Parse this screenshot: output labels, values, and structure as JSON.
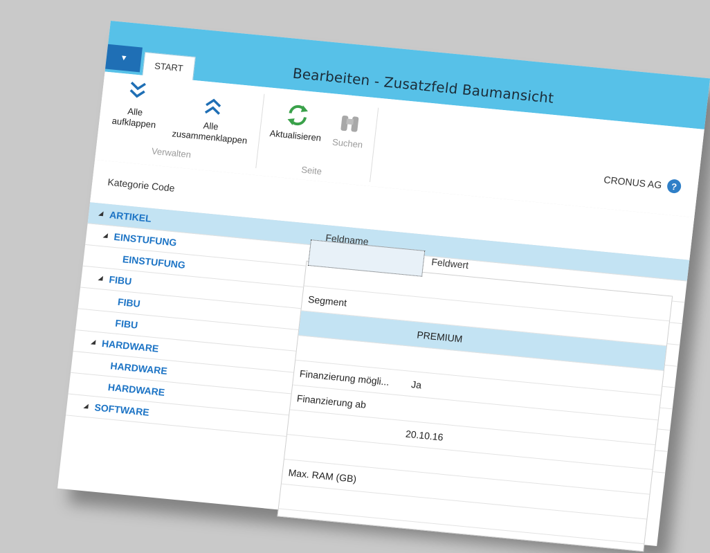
{
  "window": {
    "title": "Bearbeiten - Zusatzfeld Baumansicht",
    "app_menu_icon": "caret-down-icon",
    "tab": "START",
    "controls": {
      "minimize": "—",
      "maximize": "▢",
      "close": "x"
    },
    "company": "CRONUS AG",
    "help": "?"
  },
  "ribbon": {
    "groups": [
      {
        "label": "Verwalten",
        "buttons": [
          {
            "label_line1": "Alle",
            "label_line2": "aufklappen",
            "icon": "expand-all-icon"
          },
          {
            "label_line1": "Alle",
            "label_line2": "zusammenklappen",
            "icon": "collapse-all-icon"
          }
        ]
      },
      {
        "label": "Seite",
        "buttons": [
          {
            "label": "Aktualisieren",
            "icon": "refresh-icon"
          },
          {
            "label": "Suchen",
            "icon": "binoculars-icon",
            "disabled": true
          }
        ]
      }
    ]
  },
  "tree": {
    "column_header": "Kategorie Code",
    "rows": [
      {
        "label": "ARTIKEL",
        "level": 0,
        "expanded": true,
        "selected": true
      },
      {
        "label": "EINSTUFUNG",
        "level": 1,
        "expanded": true
      },
      {
        "label": "EINSTUFUNG",
        "level": 2
      },
      {
        "label": "FIBU",
        "level": 1,
        "expanded": true
      },
      {
        "label": "FIBU",
        "level": 2
      },
      {
        "label": "FIBU",
        "level": 2
      },
      {
        "label": "HARDWARE",
        "level": 1,
        "expanded": true
      },
      {
        "label": "HARDWARE",
        "level": 2
      },
      {
        "label": "HARDWARE",
        "level": 2
      },
      {
        "label": "SOFTWARE",
        "level": 1,
        "expanded": true
      }
    ]
  },
  "detail": {
    "headers": {
      "feldname": "Feldname",
      "feldwert": "Feldwert"
    },
    "rows": [
      {
        "feldname": "",
        "feldwert": ""
      },
      {
        "feldname": "Segment",
        "feldwert": ""
      },
      {
        "feldname": "",
        "feldwert": "PREMIUM",
        "selected": true
      },
      {
        "feldname": "",
        "feldwert": ""
      },
      {
        "feldname": "Finanzierung mögli...",
        "feldwert": "Ja"
      },
      {
        "feldname": "Finanzierung ab",
        "feldwert": ""
      },
      {
        "feldname": "",
        "feldwert": "20.10.16"
      },
      {
        "feldname": "",
        "feldwert": ""
      },
      {
        "feldname": "Max. RAM (GB)",
        "feldwert": ""
      },
      {
        "feldname": "",
        "feldwert": ""
      }
    ]
  },
  "colors": {
    "titlebar": "#57c1e8",
    "accent": "#1f6fb5",
    "link": "#1d74c5",
    "selection": "#c3e3f3",
    "close": "#c75050"
  }
}
